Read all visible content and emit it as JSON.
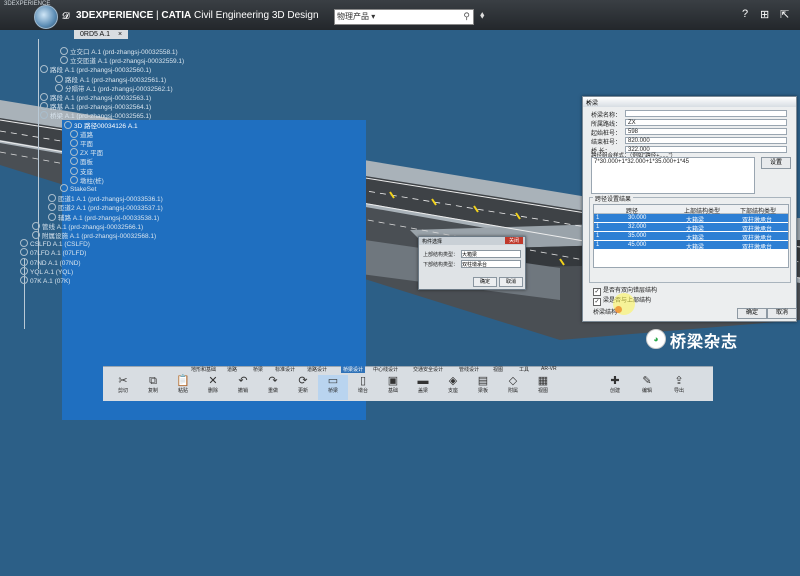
{
  "window": {
    "tiny_title": "3DEXPERIENCE"
  },
  "header": {
    "brand_prefix": "3DEXPERIENCE",
    "brand_sep": " | ",
    "brand_app": "CATIA",
    "brand_product": " Civil Engineering 3D Design",
    "search_scope": "物理产品",
    "tab_label": "0RD5 A.1"
  },
  "tree": {
    "rows": [
      {
        "label": "立交口 A.1 (prd-zhangsj-00032558.1)",
        "sel": false
      },
      {
        "label": "立交匝道 A.1 (prd-zhangsj-00032559.1)",
        "sel": false
      },
      {
        "label": "路段 A.1 (prd-zhangsj-00032560.1)",
        "sel": false
      },
      {
        "label": "路段 A.1 (prd-zhangsj-00032561.1)",
        "sel": false
      },
      {
        "label": "分隔带 A.1 (prd-zhangsj-00032562.1)",
        "sel": false
      },
      {
        "label": "路段 A.1 (prd-zhangsj-00032563.1)",
        "sel": false
      },
      {
        "label": "路基 A.1 (prd-zhangsj-00032564.1)",
        "sel": false
      },
      {
        "label": "桥梁 A.1 (prd-zhangsj-00032565.1)",
        "sel": false
      },
      {
        "label": "3D 路径00034126 A.1",
        "sel": true
      },
      {
        "label": "道路",
        "sel": false
      },
      {
        "label": "平面",
        "sel": false
      },
      {
        "label": "ZX 平面",
        "sel": false
      },
      {
        "label": "面板",
        "sel": false
      },
      {
        "label": "支座",
        "sel": false
      },
      {
        "label": "墩柱(桩)",
        "sel": false
      },
      {
        "label": "StakeSet",
        "sel": false
      },
      {
        "label": "匝道1 A.1 (prd-zhangsj-00033536.1)",
        "sel": false
      },
      {
        "label": "匝道2 A.1 (prd-zhangsj-00033537.1)",
        "sel": false
      },
      {
        "label": "辅路 A.1 (prd-zhangsj-00033538.1)",
        "sel": false
      },
      {
        "label": "管线 A.1 (prd-zhangsj-00032566.1)",
        "sel": false
      },
      {
        "label": "附属设施 A.1 (prd-zhangsj-00032568.1)",
        "sel": false
      },
      {
        "label": "CSLFD A.1 (CSLFD)",
        "sel": false
      },
      {
        "label": "07LFD A.1 (07LFD)",
        "sel": false
      },
      {
        "label": "07ND A.1 (07ND)",
        "sel": false
      },
      {
        "label": "YQL A.1 (YQL)",
        "sel": false
      },
      {
        "label": "07K A.1 (07K)",
        "sel": false
      }
    ]
  },
  "dialog": {
    "title": "桥梁",
    "close": "×",
    "fields": [
      {
        "label": "桥梁名称：",
        "value": ""
      },
      {
        "label": "所属路线：",
        "value": "ZX"
      },
      {
        "label": "起始桩号：",
        "value": "598"
      },
      {
        "label": "结束桩号：",
        "value": "820.000"
      },
      {
        "label": "桥    长：",
        "value": "322.000"
      }
    ],
    "span_label": "跨径组合样式：（例如\"跨径+......\"）",
    "span_value": "7*30.000+1*32.000+1*35.000+1*45",
    "set_button": "设置",
    "group_title": "跨径设置结果",
    "table_headers": [
      "",
      "跨径",
      "上部结构类型",
      "下部结构类型"
    ],
    "table_rows": [
      [
        "1",
        "30.000",
        "大箱梁",
        "双柱墩承台"
      ],
      [
        "1",
        "32.000",
        "大箱梁",
        "双柱墩承台"
      ],
      [
        "1",
        "35.000",
        "大箱梁",
        "双柱墩承台"
      ],
      [
        "1",
        "45.000",
        "大箱梁",
        "双柱墩承台"
      ]
    ],
    "check1": "是否有双向错层结构",
    "check2": "梁是否与上部结构",
    "check3": "桥梁结构",
    "ok": "确定",
    "cancel": "取消"
  },
  "small_dialog": {
    "title": "构件选择",
    "title_btn": "关闭",
    "row1_label": "上部结构类型：",
    "row1_value": "大箱梁",
    "row2_label": "下部结构类型：",
    "row2_value": "双柱墩承台",
    "ok": "确定",
    "cancel": "取消"
  },
  "ribbon": {
    "tabs": [
      "地形和基础",
      "道路",
      "桥梁",
      "标准设计",
      "道路设计",
      "桥梁设计",
      "中心线设计",
      "交通安全设计",
      "管线设计",
      "视图",
      "工具",
      "AR-VR"
    ],
    "active_tab": 5,
    "buttons": [
      {
        "label": "剪切",
        "glyph": "✂"
      },
      {
        "label": "复制",
        "glyph": "⧉"
      },
      {
        "label": "粘贴",
        "glyph": "📋"
      },
      {
        "label": "删除",
        "glyph": "✕"
      },
      {
        "label": "撤销",
        "glyph": "↶"
      },
      {
        "label": "重做",
        "glyph": "↷"
      },
      {
        "label": "更新",
        "glyph": "⟳"
      },
      {
        "label": "桥梁",
        "glyph": "▭"
      },
      {
        "label": "墩台",
        "glyph": "▯"
      },
      {
        "label": "基础",
        "glyph": "▣"
      },
      {
        "label": "盖梁",
        "glyph": "▬"
      },
      {
        "label": "支座",
        "glyph": "◈"
      },
      {
        "label": "梁板",
        "glyph": "▤"
      },
      {
        "label": "附属",
        "glyph": "◇"
      },
      {
        "label": "视图",
        "glyph": "▦"
      },
      {
        "label": "创建",
        "glyph": "✚"
      },
      {
        "label": "编辑",
        "glyph": "✎"
      },
      {
        "label": "导出",
        "glyph": "⇪"
      }
    ]
  },
  "watermark": {
    "text": "桥梁杂志"
  },
  "colors": {
    "background": "#2c5f87",
    "selection": "#2d7fd4",
    "topbar": "#2b2f33"
  }
}
